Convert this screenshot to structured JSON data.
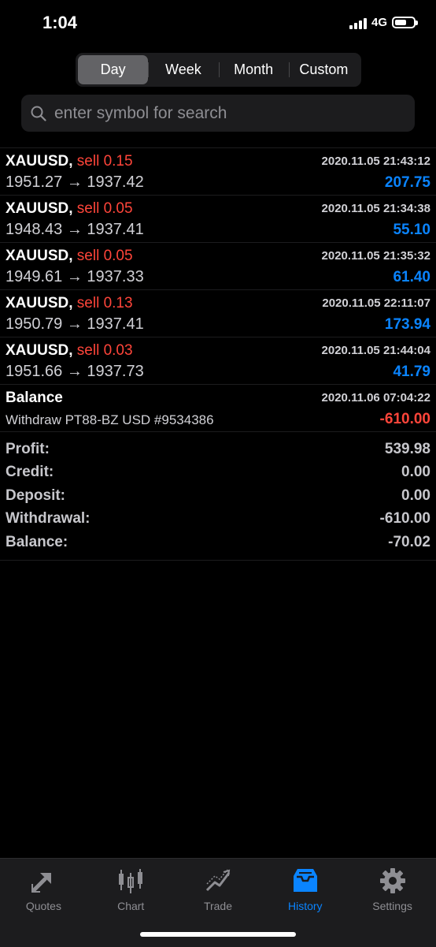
{
  "status": {
    "time": "1:04",
    "network": "4G"
  },
  "period_tabs": [
    {
      "label": "Day",
      "active": true
    },
    {
      "label": "Week",
      "active": false
    },
    {
      "label": "Month",
      "active": false
    },
    {
      "label": "Custom",
      "active": false
    }
  ],
  "search": {
    "placeholder": "enter symbol for search"
  },
  "trades": [
    {
      "symbol": "XAUUSD,",
      "type": "sell 0.15",
      "time": "2020.11.05 21:43:12",
      "prices": "1951.27 → 1937.42",
      "profit": "207.75"
    },
    {
      "symbol": "XAUUSD,",
      "type": "sell 0.05",
      "time": "2020.11.05 21:34:38",
      "prices": "1948.43 → 1937.41",
      "profit": "55.10"
    },
    {
      "symbol": "XAUUSD,",
      "type": "sell 0.05",
      "time": "2020.11.05 21:35:32",
      "prices": "1949.61 → 1937.33",
      "profit": "61.40"
    },
    {
      "symbol": "XAUUSD,",
      "type": "sell 0.13",
      "time": "2020.11.05 22:11:07",
      "prices": "1950.79 → 1937.41",
      "profit": "173.94"
    },
    {
      "symbol": "XAUUSD,",
      "type": "sell 0.03",
      "time": "2020.11.05 21:44:04",
      "prices": "1951.66 → 1937.73",
      "profit": "41.79"
    }
  ],
  "balance_op": {
    "title": "Balance",
    "time": "2020.11.06 07:04:22",
    "description": "Withdraw PT88-BZ USD #9534386",
    "amount": "-610.00"
  },
  "summary": [
    {
      "label": "Profit:",
      "value": "539.98"
    },
    {
      "label": "Credit:",
      "value": "0.00"
    },
    {
      "label": "Deposit:",
      "value": "0.00"
    },
    {
      "label": "Withdrawal:",
      "value": "-610.00"
    },
    {
      "label": "Balance:",
      "value": "-70.02"
    }
  ],
  "tabbar": [
    {
      "label": "Quotes",
      "icon": "quotes-icon",
      "active": false
    },
    {
      "label": "Chart",
      "icon": "chart-candles-icon",
      "active": false
    },
    {
      "label": "Trade",
      "icon": "trade-icon",
      "active": false
    },
    {
      "label": "History",
      "icon": "history-inbox-icon",
      "active": true
    },
    {
      "label": "Settings",
      "icon": "gear-icon",
      "active": false
    }
  ],
  "colors": {
    "accent": "#0a84ff",
    "loss": "#ff453a",
    "background": "#000000"
  }
}
